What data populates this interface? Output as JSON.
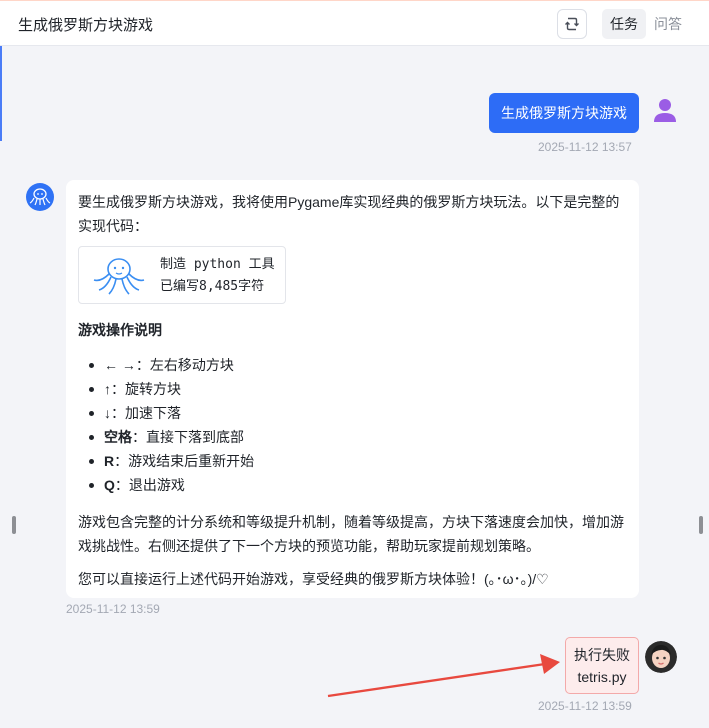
{
  "header": {
    "title": "生成俄罗斯方块游戏",
    "tabs": [
      {
        "label": "任务",
        "active": true
      },
      {
        "label": "问答",
        "active": false
      }
    ],
    "icon": "share-icon"
  },
  "user_message": {
    "text": "生成俄罗斯方块游戏",
    "timestamp": "2025-11-12 13:57"
  },
  "bot_message": {
    "intro": "要生成俄罗斯方块游戏，我将使用Pygame库实现经典的俄罗斯方块玩法。以下是完整的实现代码：",
    "tool": {
      "line1": "制造 python 工具",
      "line2": "已编写8,485字符"
    },
    "section_title": "游戏操作说明",
    "operations": [
      {
        "key": "← →",
        "text": "：左右移动方块",
        "bold": false
      },
      {
        "key": "↑",
        "text": "：旋转方块",
        "bold": false
      },
      {
        "key": "↓",
        "text": "：加速下落",
        "bold": false
      },
      {
        "key": "空格",
        "text": "：直接下落到底部",
        "bold": true
      },
      {
        "key": "R",
        "text": "：游戏结束后重新开始",
        "bold": true
      },
      {
        "key": "Q",
        "text": "：退出游戏",
        "bold": true
      }
    ],
    "description": "游戏包含完整的计分系统和等级提升机制，随着等级提高，方块下落速度会加快，增加游戏挑战性。右侧还提供了下一个方块的预览功能，帮助玩家提前规划策略。",
    "closing": "您可以直接运行上述代码开始游戏，享受经典的俄罗斯方块体验！(｡･ω･｡)/♡",
    "timestamp": "2025-11-12 13:59"
  },
  "fail_message": {
    "status": "执行失败",
    "file": "tetris.py",
    "timestamp": "2025-11-12 13:59"
  },
  "colors": {
    "accent": "#2d6cf6",
    "fail_bg": "#fdecec",
    "fail_border": "#f3a9a9",
    "arrow": "#e8493f"
  }
}
